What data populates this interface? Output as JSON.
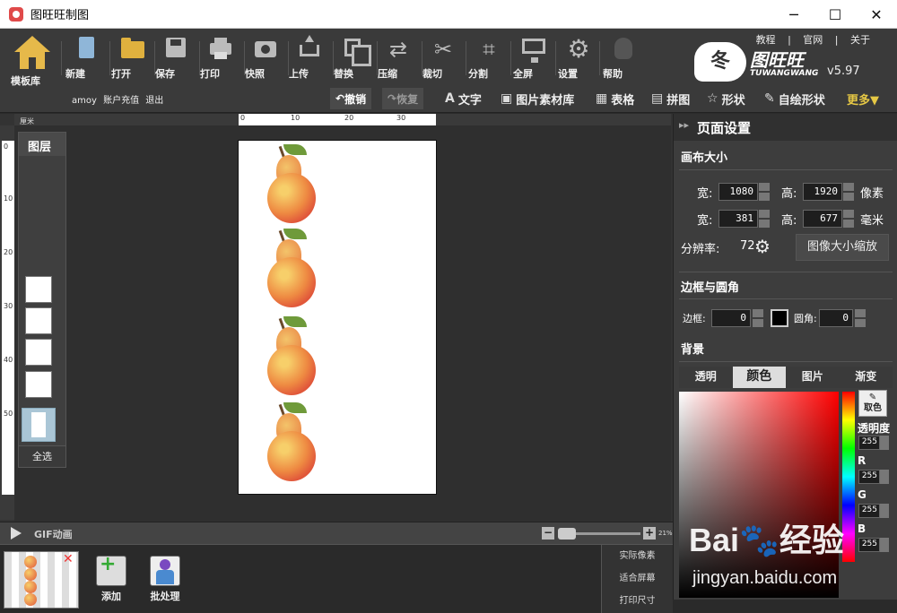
{
  "window": {
    "title": "图旺旺制图",
    "minimize": "─",
    "maximize": "☐",
    "close": "✕"
  },
  "toolbar": {
    "home": "模板库",
    "new": "新建",
    "open": "打开",
    "save": "保存",
    "print": "打印",
    "snapshot": "快照",
    "upload": "上传",
    "replace": "替换",
    "compress": "压缩",
    "cut": "裁切",
    "split": "分割",
    "fullscreen": "全屏",
    "settings": "设置",
    "help": "帮助"
  },
  "toplinks": {
    "tutorial": "教程",
    "site": "官网",
    "about": "关于",
    "sep": "|"
  },
  "logo": {
    "mark": "冬",
    "name": "图旺旺",
    "sub": "TUWANGWANG",
    "version": "v5.97"
  },
  "user": {
    "name": "amoy",
    "recharge": "账户充值",
    "logout": "退出"
  },
  "edit": {
    "undo": "撤销",
    "redo": "恢复"
  },
  "tools": {
    "text": "文字",
    "material": "图片素材库",
    "table": "表格",
    "collage": "拼图",
    "shape": "形状",
    "freeform": "自绘形状",
    "more": "更多▼"
  },
  "ruler": {
    "unit": "厘米",
    "top": [
      "0",
      "10",
      "20",
      "30"
    ],
    "left": [
      "0",
      "10",
      "20",
      "30",
      "40",
      "50"
    ]
  },
  "layers": {
    "title": "图层",
    "select_all": "全选"
  },
  "status": {
    "gif": "GIF动画",
    "zoom_minus": "−",
    "zoom_plus": "+",
    "zoom": "21%",
    "zoom_fraction": 0.21
  },
  "bottom": {
    "add": "添加",
    "batch": "批处理",
    "actual_pixels": "实际像素",
    "fit_screen": "适合屏幕",
    "print_size": "打印尺寸",
    "close": "✕"
  },
  "panel": {
    "title": "页面设置",
    "canvas_size": "画布大小",
    "width": "宽:",
    "height": "高:",
    "width_px": "1080",
    "height_px": "1920",
    "unit_px": "像素",
    "width_mm": "381",
    "height_mm": "677",
    "unit_mm": "毫米",
    "resolution_label": "分辨率:",
    "resolution": "72",
    "scale_button": "图像大小缩放",
    "border_section": "边框与圆角",
    "border_label": "边框:",
    "border_value": "0",
    "corner_label": "圆角:",
    "corner_value": "0",
    "background": "背景",
    "bg_tabs": [
      "透明",
      "颜色",
      "图片",
      "渐变"
    ],
    "pick_color": "取色",
    "opacity": "透明度",
    "opacity_value": "255",
    "r": "R",
    "r_value": "255",
    "g": "G",
    "g_value": "255",
    "b": "B",
    "b_value": "255",
    "border_color": "#000000"
  },
  "watermark": {
    "main": "Bai🐾经验",
    "sub": "jingyan.baidu.com"
  }
}
